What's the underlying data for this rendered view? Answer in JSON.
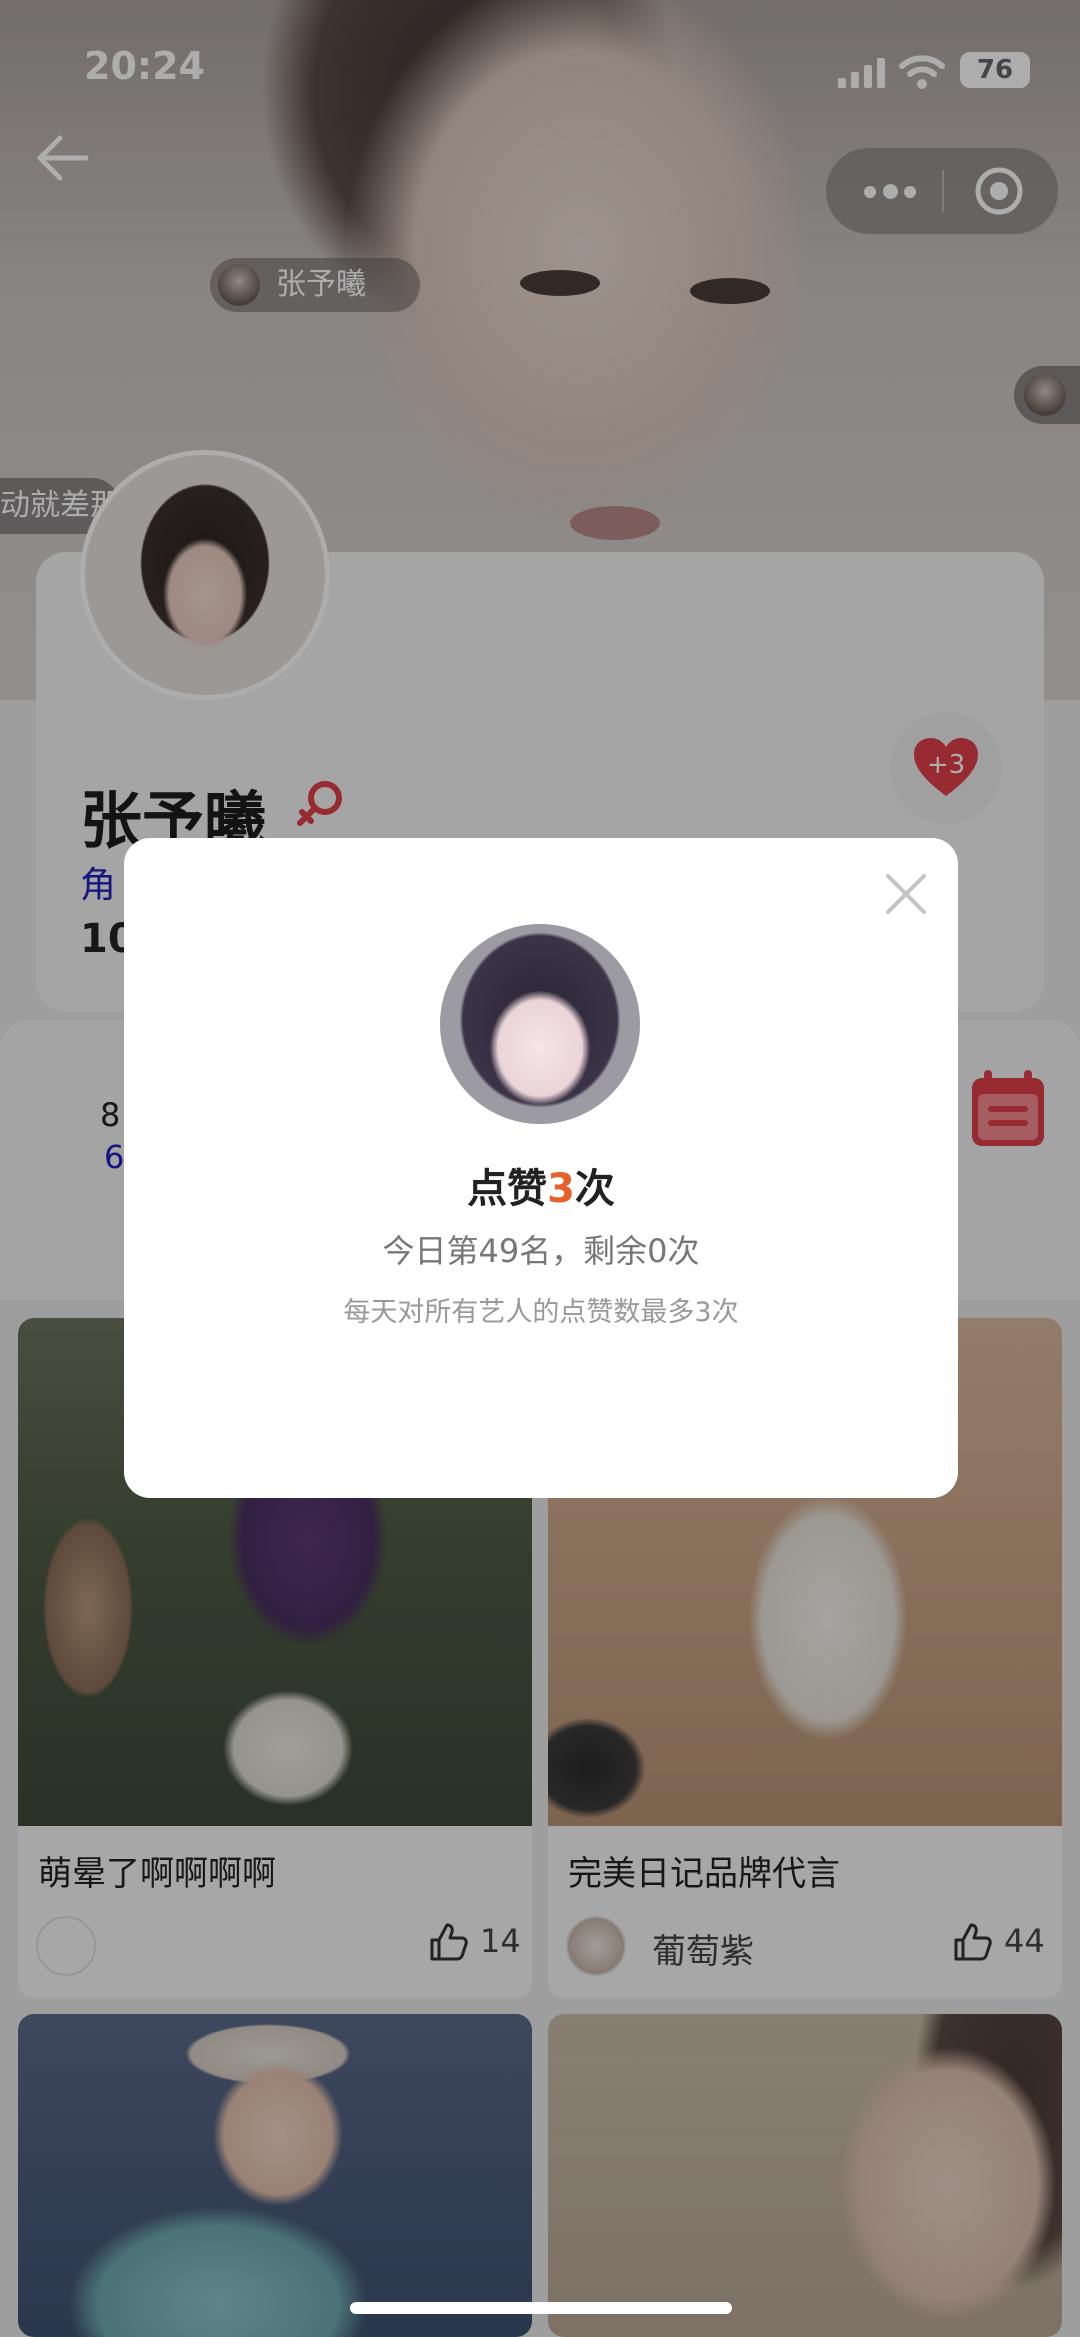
{
  "status_bar": {
    "time": "20:24",
    "battery": "76"
  },
  "header": {
    "chip_name": "张予曦",
    "left_tag": "动就差那"
  },
  "profile": {
    "name": "张予曦",
    "role_prefix": "角",
    "count_prefix": "10",
    "heart_badge": "+3",
    "gender_icon": "female-icon"
  },
  "stats": {
    "rank_prefix": "8",
    "votes_prefix": "6"
  },
  "posts": [
    {
      "title": "萌晕了啊啊啊啊",
      "author": "",
      "likes": "14"
    },
    {
      "title": "完美日记品牌代言",
      "author": "葡萄紫",
      "likes": "44"
    }
  ],
  "modal": {
    "title_pre": "点赞",
    "title_num": "3",
    "title_post": "次",
    "subtitle": "今日第49名，剩余0次",
    "note": "每天对所有艺人的点赞数最多3次"
  },
  "colors": {
    "accent_orange": "#e8602c",
    "heart_red": "#e0404a",
    "link_blue": "#2020c0"
  }
}
